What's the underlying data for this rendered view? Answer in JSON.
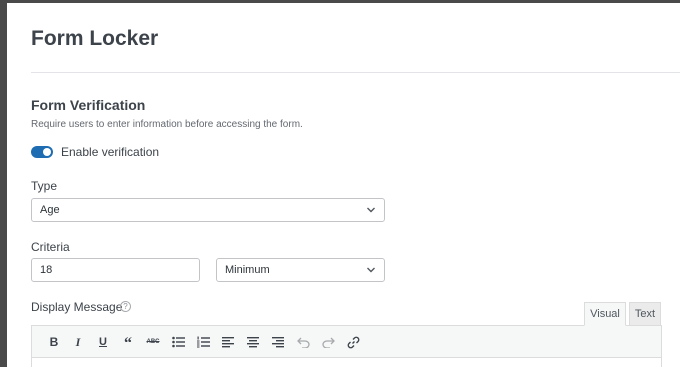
{
  "page": {
    "title": "Form Locker"
  },
  "section": {
    "title": "Form Verification",
    "description": "Require users to enter information before accessing the form."
  },
  "toggle": {
    "label": "Enable verification",
    "enabled": true,
    "color": "#1e6db3"
  },
  "type": {
    "label": "Type",
    "value": "Age"
  },
  "criteria": {
    "label": "Criteria",
    "value": "18",
    "comparison": "Minimum"
  },
  "message": {
    "label": "Display Message",
    "help_icon": "?"
  },
  "editor": {
    "tabs": [
      {
        "label": "Visual",
        "active": true
      },
      {
        "label": "Text",
        "active": false
      }
    ],
    "toolbar": [
      "bold-icon",
      "italic-icon",
      "underline-icon",
      "blockquote-icon",
      "strikethrough-icon",
      "bulleted-list-icon",
      "numbered-list-icon",
      "align-left-icon",
      "align-center-icon",
      "align-right-icon",
      "undo-icon",
      "redo-icon",
      "link-icon"
    ]
  }
}
